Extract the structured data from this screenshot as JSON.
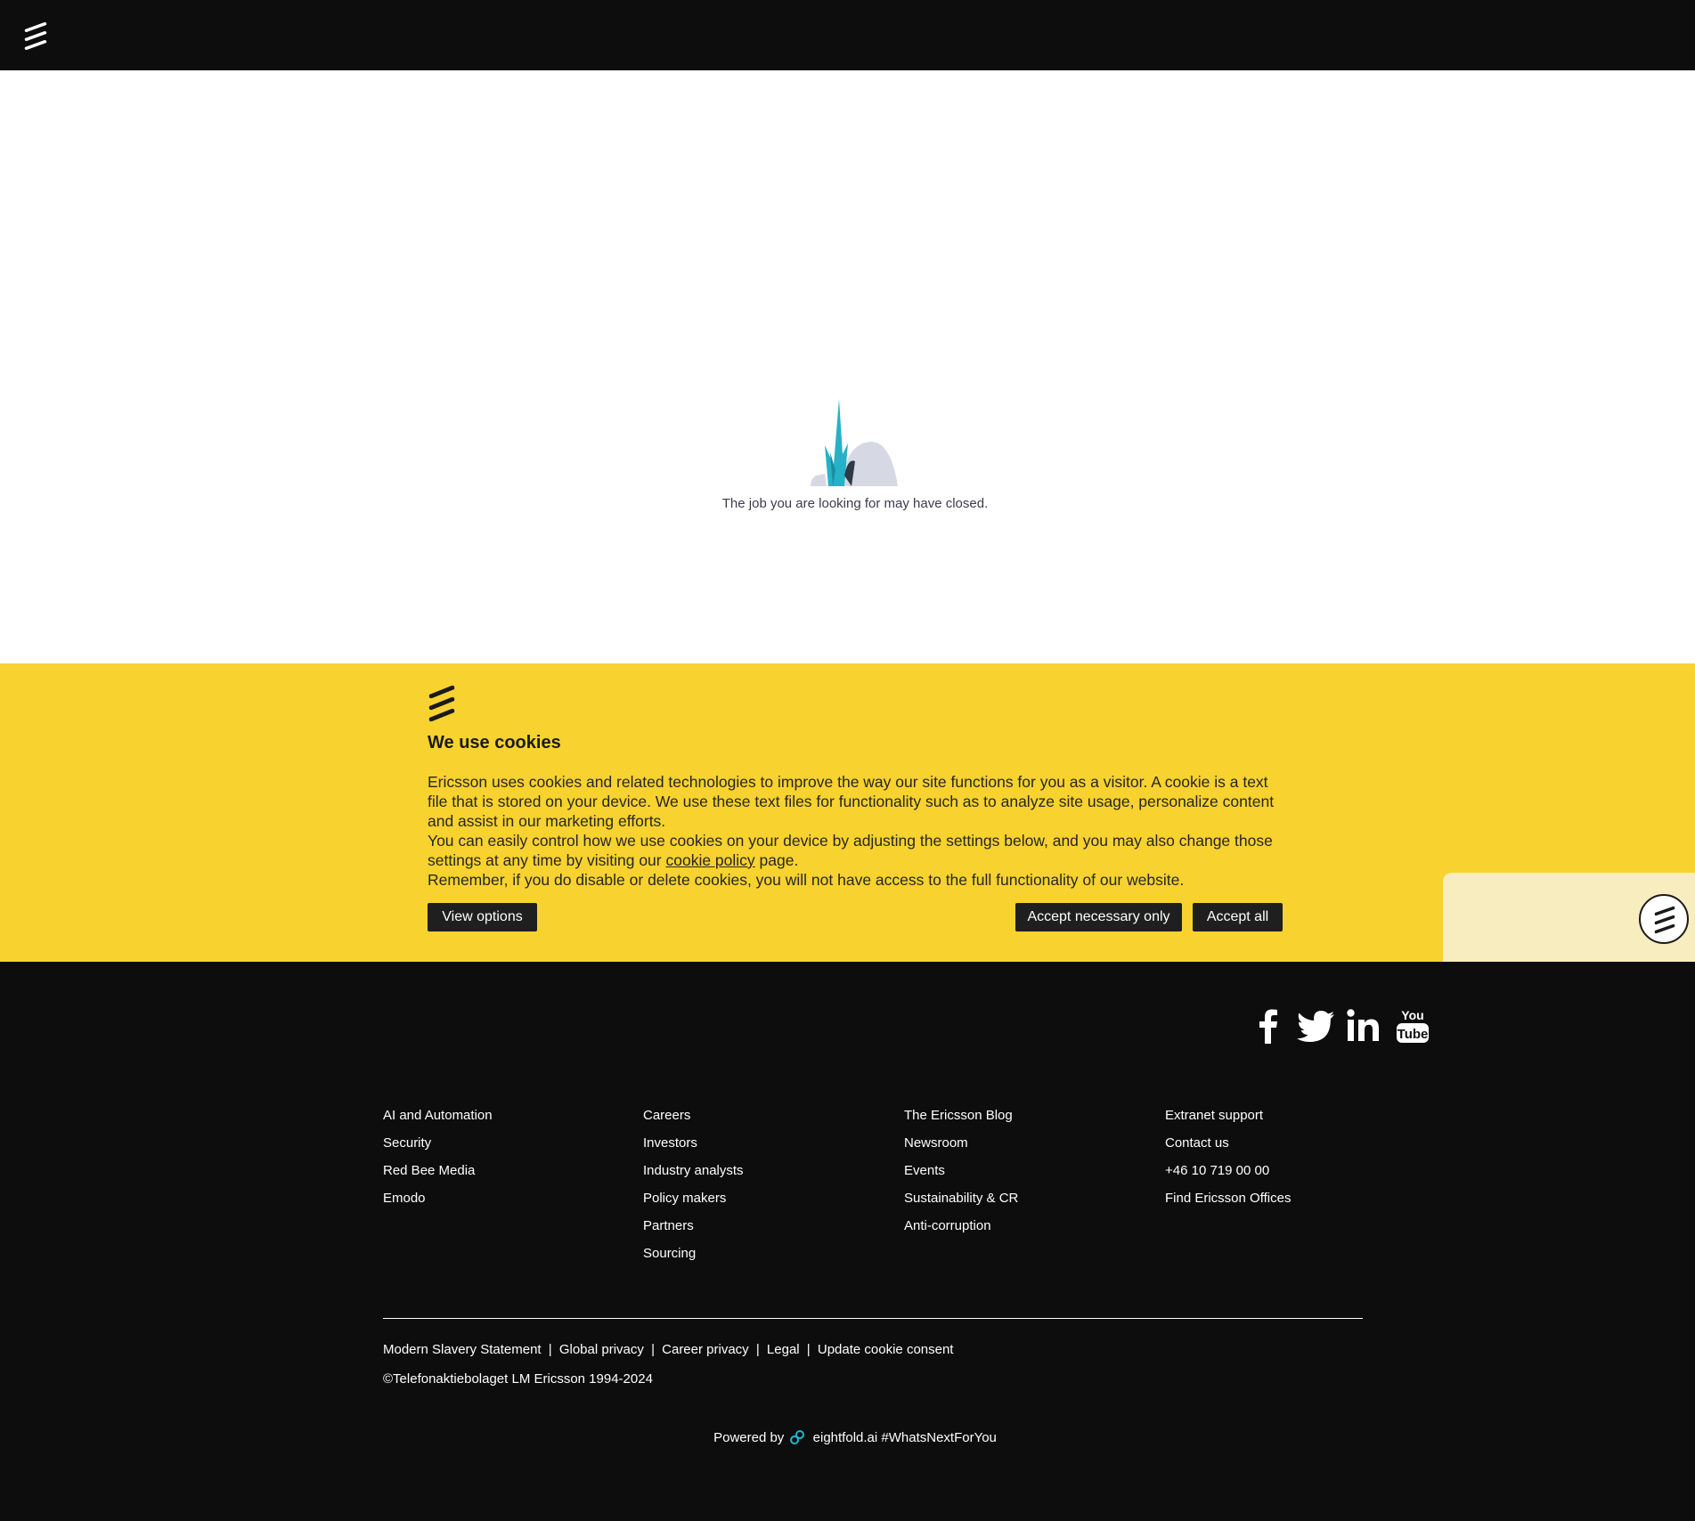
{
  "header": {
    "logo_icon": "ericsson-logo-icon"
  },
  "main": {
    "illustration_icon": "closed-job-illustration-icon",
    "message": "The job you are looking for may have closed."
  },
  "cookie_banner": {
    "logo_icon": "ericsson-logo-icon",
    "title": "We use cookies",
    "paragraph_1": "Ericsson uses cookies and related technologies to improve the way our site functions for you as a visitor. A cookie is a text file that is stored on your device. We use these text files for functionality such as to analyze site usage, personalize content and assist in our marketing efforts.",
    "paragraph_2_before": "You can easily control how we use cookies on your device by adjusting the settings below, and you may also change those settings at any time by visiting our ",
    "paragraph_2_link": "cookie policy",
    "paragraph_2_after": " page.",
    "paragraph_3": "Remember, if you do disable or delete cookies, you will not have access to the full functionality of our website.",
    "view_options_label": "View options",
    "accept_necessary_label": "Accept necessary only",
    "accept_all_label": "Accept all",
    "background_color": "#f8d22e"
  },
  "chat_widget": {
    "icon": "ericsson-chat-icon"
  },
  "footer": {
    "social_icons": [
      "facebook-icon",
      "twitter-icon",
      "linkedin-icon",
      "youtube-icon"
    ],
    "columns": [
      [
        "AI and Automation",
        "Security",
        "Red Bee Media",
        "Emodo"
      ],
      [
        "Careers",
        "Investors",
        "Industry analysts",
        "Policy makers",
        "Partners",
        "Sourcing"
      ],
      [
        "The Ericsson Blog",
        "Newsroom",
        "Events",
        "Sustainability & CR",
        "Anti-corruption"
      ],
      [
        "Extranet support",
        "Contact us",
        "+46 10 719 00 00",
        "Find Ericsson Offices"
      ]
    ],
    "legal_links": [
      "Modern Slavery Statement",
      "Global privacy",
      "Career privacy",
      "Legal",
      "Update cookie consent"
    ],
    "legal_separator": "|",
    "copyright": "©Telefonaktiebolaget LM Ericsson 1994-2024",
    "powered_prefix": "Powered by",
    "powered_brand": "eightfold.ai",
    "powered_hashtag": "#WhatsNextForYou",
    "brand_accent": "#1fb6cf"
  }
}
